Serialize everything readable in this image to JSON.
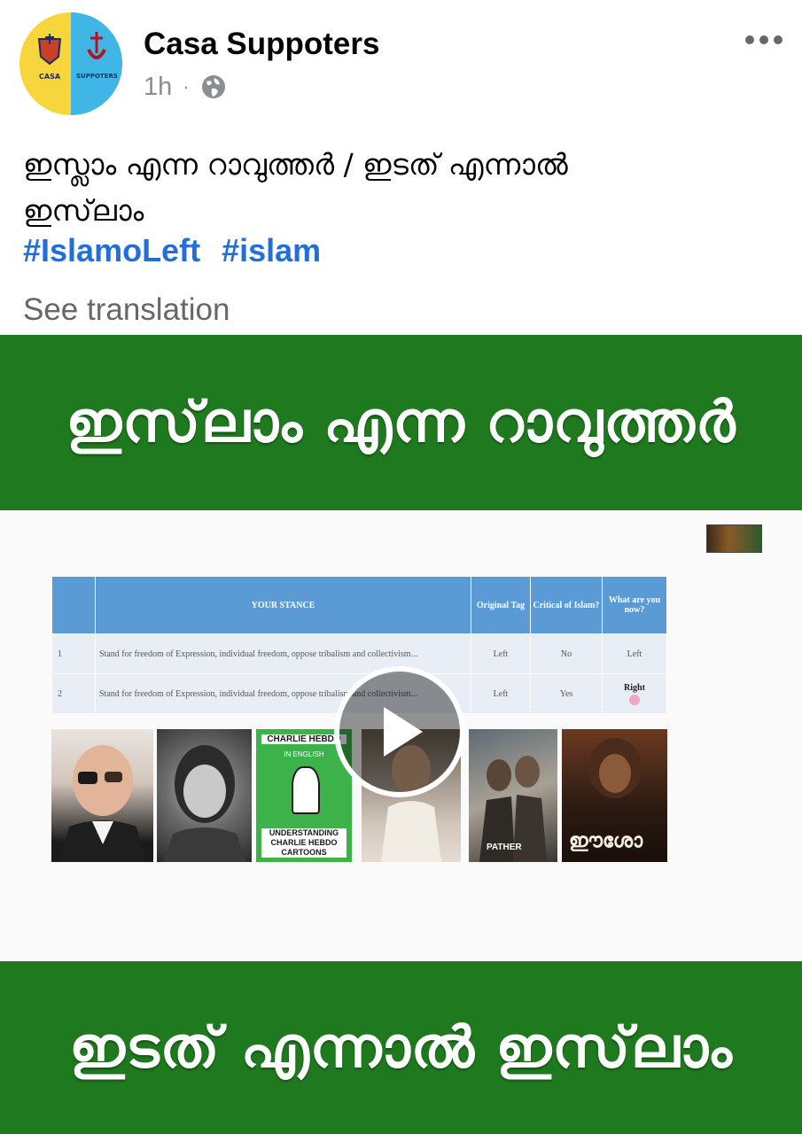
{
  "post": {
    "author": "Casa Suppoters",
    "time": "1h",
    "separator": "·",
    "privacy_icon": "globe-icon",
    "more_icon": "more-options-icon",
    "avatar_labels": {
      "left": "CASA",
      "right": "SUPPOTERS"
    },
    "text_line1": "ഇസ്ലാം എന്ന റാവുത്തർ / ഇടത് എന്നാൽ",
    "text_line2": "ഇസ്‌ലാം",
    "hashtags": [
      "#IslamoLeft",
      "#islam"
    ],
    "see_translation": "See translation"
  },
  "video": {
    "banner_top": "ഇസ്‌ലാം എന്ന റാവുത്തർ",
    "banner_bottom": "ഇടത് എന്നാൽ ഇസ്‌ലാം",
    "banner_color": "#1f7a1f",
    "play_icon": "play-icon",
    "table": {
      "headers": [
        "",
        "YOUR STANCE",
        "Original Tag",
        "Critical of Islam?",
        "What are you now?"
      ],
      "rows": [
        [
          "1",
          "Stand for freedom of Expression, individual freedom, oppose tribalism and collectivism...",
          "Left",
          "No",
          "Left"
        ],
        [
          "2",
          "Stand for freedom of Expression, individual freedom, oppose tribalism and collectivism...",
          "Left",
          "Yes",
          "Right"
        ]
      ]
    },
    "thumbnails": {
      "charlie": {
        "title": "CHARLIE HEBDO",
        "sub": "IN ENGLISH",
        "bottom1": "UNDERSTANDING",
        "bottom2": "CHARLIE HEBDO",
        "bottom3": "CARTOONS"
      },
      "poster5_title": "PATHER",
      "poster6_title": "ഈശോ"
    }
  },
  "colors": {
    "hashtag": "#216fdb",
    "muted": "#65676b",
    "table_header": "#5b9bd5"
  }
}
